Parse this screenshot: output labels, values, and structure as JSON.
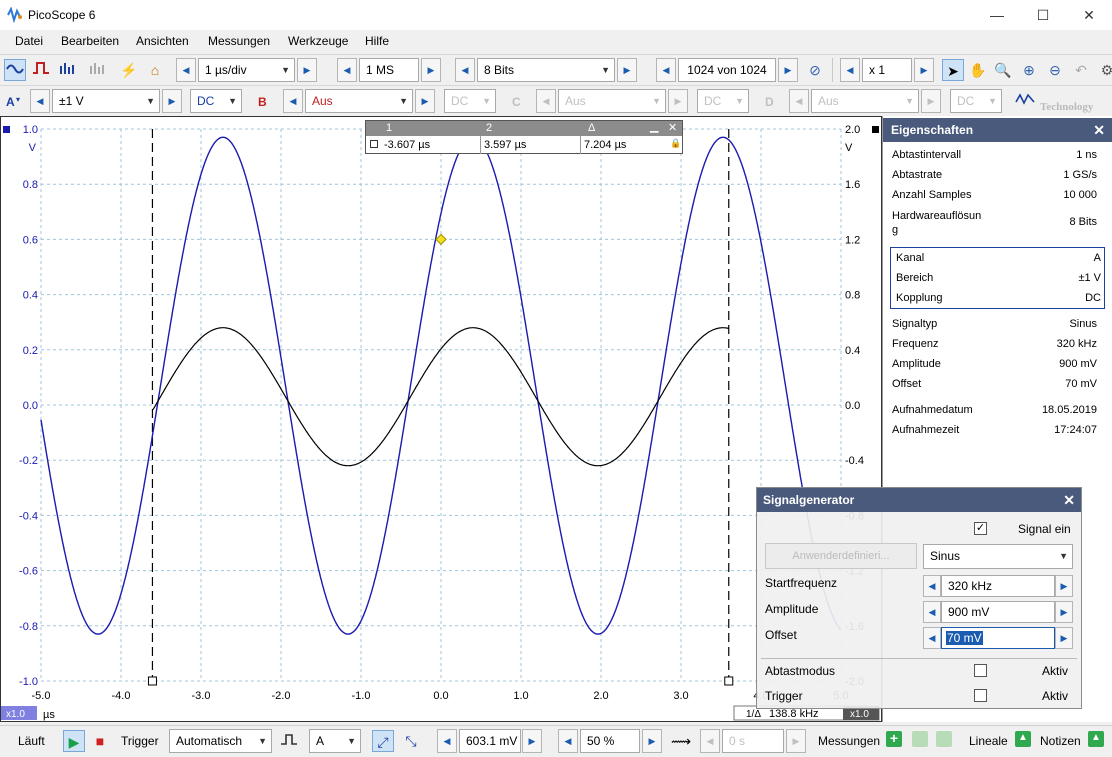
{
  "app": {
    "title": "PicoScope 6"
  },
  "window": {
    "minimize": "—",
    "maximize": "☐",
    "close": "✕"
  },
  "menu": [
    "Datei",
    "Bearbeiten",
    "Ansichten",
    "Messungen",
    "Werkzeuge",
    "Hilfe"
  ],
  "toolbar1": {
    "timebase": "1 µs/div",
    "samples": "1 MS",
    "resolution": "8 Bits",
    "buffer": "1024 von 1024",
    "zoom": "x 1"
  },
  "toolbar2": {
    "a": {
      "label": "A",
      "range": "±1 V",
      "coupling": "DC"
    },
    "b": {
      "label": "B",
      "range": "Aus",
      "coupling": "DC"
    },
    "c": {
      "label": "C",
      "range": "Aus",
      "coupling": "DC"
    },
    "d": {
      "label": "D",
      "range": "Aus",
      "coupling": "DC"
    },
    "logo": "Technology"
  },
  "axes": {
    "left_ticks": [
      "1.0",
      "0.8",
      "0.6",
      "0.4",
      "0.2",
      "0.0",
      "-0.2",
      "-0.4",
      "-0.6",
      "-0.8",
      "-1.0"
    ],
    "left_unit": "V",
    "right_ticks": [
      "2.0",
      "1.6",
      "1.2",
      "0.8",
      "0.4",
      "0.0",
      "-0.4",
      "-0.8",
      "-1.2",
      "-1.6",
      "-2.0"
    ],
    "right_unit": "V",
    "x_ticks": [
      "-5.0",
      "-4.0",
      "-3.0",
      "-2.0",
      "-1.0",
      "0.0",
      "1.0",
      "2.0",
      "3.0",
      "4.0",
      "5.0"
    ],
    "x_unit": "µs",
    "x_zoom": "x1.0",
    "right_zoom": "x1.0",
    "freq_prefix": "1/Δ",
    "freq_value": "138.8 kHz"
  },
  "cursor_table": {
    "h1": "1",
    "h2": "2",
    "h3": "Δ",
    "v1": "-3.607 µs",
    "v2": "3.597 µs",
    "v3": "7.204 µs"
  },
  "chart_data": {
    "type": "line",
    "x_range": [
      -5,
      5
    ],
    "y_range_left": [
      -1,
      1
    ],
    "y_range_right": [
      -2,
      2
    ],
    "series": [
      {
        "color": "#1a1ab0",
        "frequency_khz": 320,
        "amplitude_v": 0.9,
        "offset_v": 0.07,
        "peak_v": 0.97,
        "trough_v": -0.83
      },
      {
        "color": "#000000",
        "amplitude_v": 0.25,
        "offset_v": 0.03,
        "x_start": -3.6,
        "x_end": 3.6
      }
    ],
    "cursors_us": [
      -3.607,
      3.597
    ],
    "grid": true
  },
  "properties": {
    "title": "Eigenschaften",
    "rows1": [
      [
        "Abtastintervall",
        "1 ns"
      ],
      [
        "Abtastrate",
        "1 GS/s"
      ],
      [
        "Anzahl Samples",
        "10 000"
      ]
    ],
    "hw_label": "Hardwareauflösun\ng",
    "hw_value": "8 Bits",
    "channel": [
      [
        "Kanal",
        "A"
      ],
      [
        "Bereich",
        "±1 V"
      ],
      [
        "Kopplung",
        "DC"
      ]
    ],
    "rows2": [
      [
        "Signaltyp",
        "Sinus"
      ],
      [
        "Frequenz",
        "320 kHz"
      ],
      [
        "Amplitude",
        "900 mV"
      ],
      [
        "Offset",
        "70 mV"
      ]
    ],
    "rows3": [
      [
        "Aufnahmedatum",
        "18.05.2019"
      ],
      [
        "Aufnahmezeit",
        "17:24:07"
      ]
    ]
  },
  "siggen": {
    "title": "Signalgenerator",
    "signal_on": "Signal ein",
    "arb_button": "Anwenderdefinieri...",
    "waveform": "Sinus",
    "start_freq_label": "Startfrequenz",
    "start_freq": "320 kHz",
    "amplitude_label": "Amplitude",
    "amplitude": "900 mV",
    "offset_label": "Offset",
    "offset": "70 mV",
    "sweep_label": "Abtastmodus",
    "sweep_active": "Aktiv",
    "trigger_label": "Trigger",
    "trigger_active": "Aktiv"
  },
  "status": {
    "run": "Läuft",
    "trigger_label": "Trigger",
    "trigger_mode": "Automatisch",
    "trigger_channel": "A",
    "level": "603.1 mV",
    "pretrigger": "50 %",
    "delay": "0 s",
    "measurements": "Messungen",
    "rulers": "Lineale",
    "notes": "Notizen"
  }
}
